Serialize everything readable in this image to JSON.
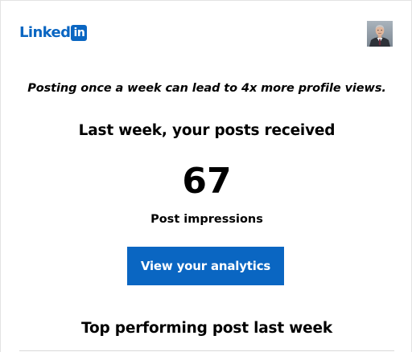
{
  "header": {
    "logo_word": "Linked",
    "logo_badge": "in",
    "avatar_icon": "profile-photo"
  },
  "tip": "Posting once a week can lead to 4x more profile views.",
  "stats": {
    "heading": "Last week, your posts received",
    "value": "67",
    "label": "Post impressions"
  },
  "cta": {
    "label": "View your analytics"
  },
  "top_post": {
    "heading": "Top performing post last week"
  },
  "colors": {
    "brand": "#0a66c2",
    "text": "#000000",
    "background": "#ffffff"
  }
}
